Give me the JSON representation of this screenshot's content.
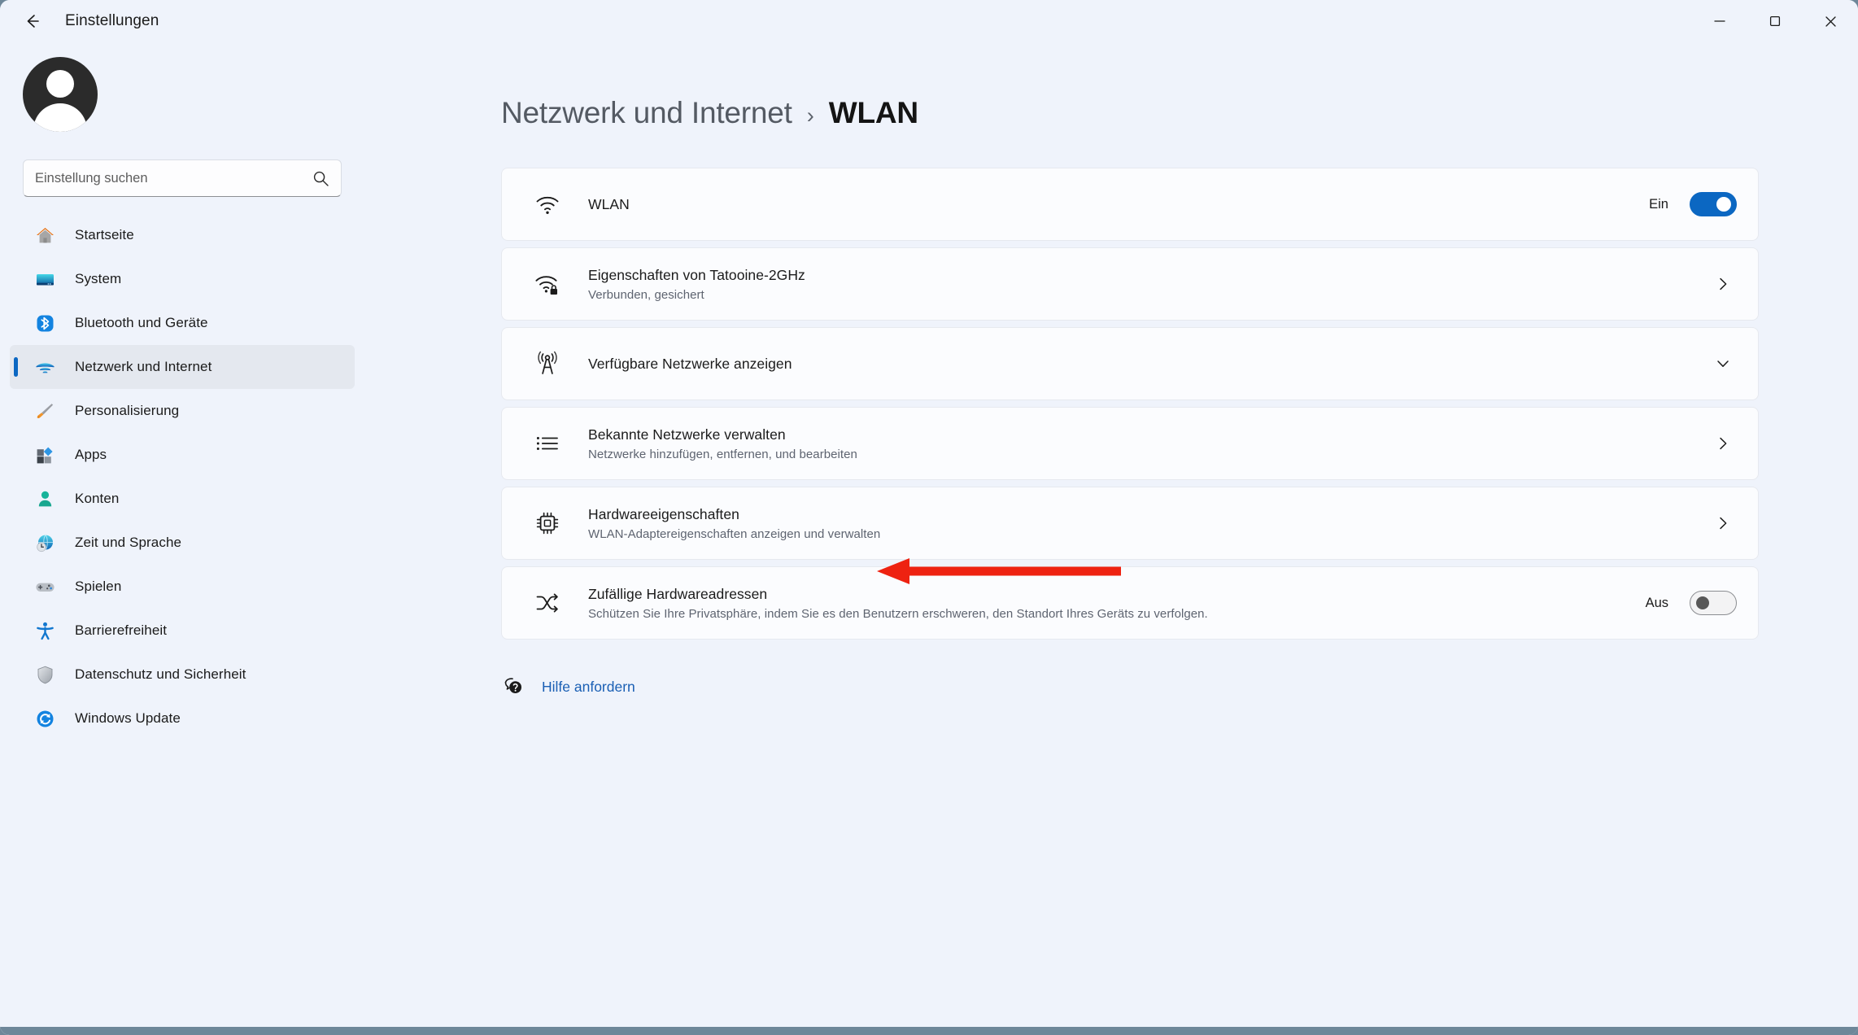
{
  "window": {
    "title": "Einstellungen",
    "back_icon": "back-arrow-icon",
    "controls": {
      "minimize": "minimize-icon",
      "maximize": "maximize-icon",
      "close": "close-icon"
    }
  },
  "sidebar": {
    "avatar": "user-avatar",
    "search": {
      "placeholder": "Einstellung suchen",
      "value": "",
      "icon": "search-icon"
    },
    "items": [
      {
        "label": "Startseite",
        "icon": "home-icon",
        "active": false
      },
      {
        "label": "System",
        "icon": "monitor-icon",
        "active": false
      },
      {
        "label": "Bluetooth und Geräte",
        "icon": "bluetooth-icon",
        "active": false
      },
      {
        "label": "Netzwerk und Internet",
        "icon": "wifi-icon",
        "active": true
      },
      {
        "label": "Personalisierung",
        "icon": "paintbrush-icon",
        "active": false
      },
      {
        "label": "Apps",
        "icon": "apps-icon",
        "active": false
      },
      {
        "label": "Konten",
        "icon": "person-icon",
        "active": false
      },
      {
        "label": "Zeit und Sprache",
        "icon": "globe-clock-icon",
        "active": false
      },
      {
        "label": "Spielen",
        "icon": "gamepad-icon",
        "active": false
      },
      {
        "label": "Barrierefreiheit",
        "icon": "accessibility-icon",
        "active": false
      },
      {
        "label": "Datenschutz und Sicherheit",
        "icon": "shield-icon",
        "active": false
      },
      {
        "label": "Windows Update",
        "icon": "update-icon",
        "active": false
      }
    ]
  },
  "main": {
    "breadcrumb": {
      "parent": "Netzwerk und Internet",
      "separator": "›",
      "current": "WLAN"
    },
    "cards": [
      {
        "title": "WLAN",
        "subtitle": "",
        "icon": "wifi-icon",
        "control": "toggle",
        "toggle_label": "Ein",
        "toggle_state": "on"
      },
      {
        "title": "Eigenschaften von Tatooine-2GHz",
        "subtitle": "Verbunden, gesichert",
        "icon": "wifi-lock-icon",
        "control": "chevron-right",
        "toggle_label": "",
        "toggle_state": ""
      },
      {
        "title": "Verfügbare Netzwerke anzeigen",
        "subtitle": "",
        "icon": "broadcast-tower-icon",
        "control": "chevron-down",
        "toggle_label": "",
        "toggle_state": ""
      },
      {
        "title": "Bekannte Netzwerke verwalten",
        "subtitle": "Netzwerke hinzufügen, entfernen, und bearbeiten",
        "icon": "list-icon",
        "control": "chevron-right",
        "toggle_label": "",
        "toggle_state": ""
      },
      {
        "title": "Hardwareeigenschaften",
        "subtitle": "WLAN-Adaptereigenschaften anzeigen und verwalten",
        "icon": "chip-icon",
        "control": "chevron-right",
        "toggle_label": "",
        "toggle_state": ""
      },
      {
        "title": "Zufällige Hardwareadressen",
        "subtitle": "Schützen Sie Ihre Privatsphäre, indem Sie es den Benutzern erschweren, den Standort Ihres Geräts zu verfolgen.",
        "icon": "shuffle-icon",
        "control": "toggle",
        "toggle_label": "Aus",
        "toggle_state": "off"
      }
    ],
    "help": {
      "icon": "help-question-icon",
      "label": "Hilfe anfordern"
    }
  },
  "annotation": {
    "type": "arrow",
    "direction": "left",
    "color": "#ee2211",
    "target": "Hardwareeigenschaften"
  },
  "colors": {
    "accent": "#0b67c2",
    "page_bg": "#eff3fb",
    "card_bg": "#fbfcfe",
    "link": "#1a5fb4",
    "annotation_red": "#ee2211"
  }
}
